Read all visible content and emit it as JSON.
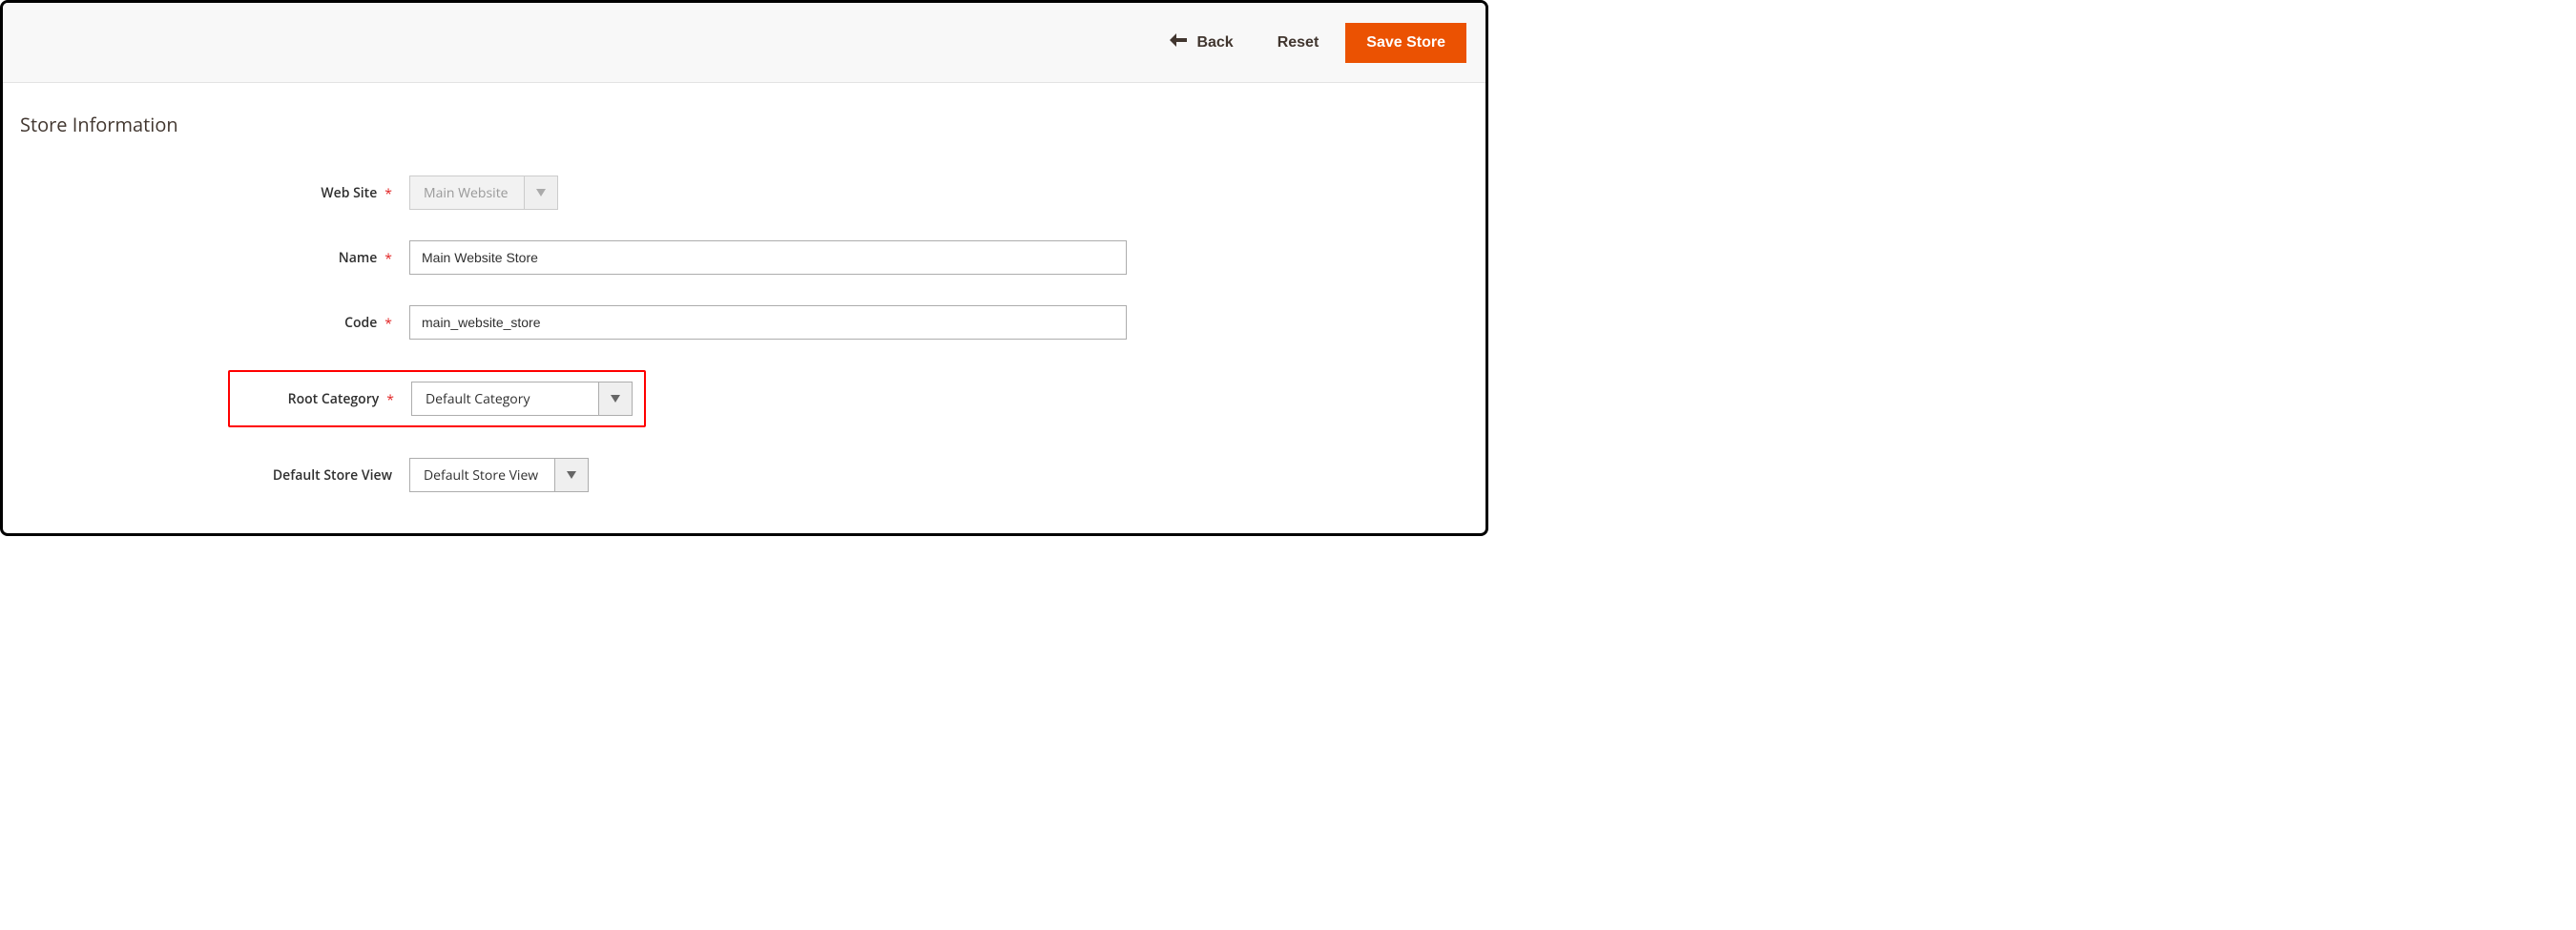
{
  "toolbar": {
    "back_label": "Back",
    "reset_label": "Reset",
    "save_label": "Save Store"
  },
  "section": {
    "title": "Store Information"
  },
  "form": {
    "website": {
      "label": "Web Site",
      "required": "*",
      "value": "Main Website"
    },
    "name": {
      "label": "Name",
      "required": "*",
      "value": "Main Website Store"
    },
    "code": {
      "label": "Code",
      "required": "*",
      "value": "main_website_store"
    },
    "root_category": {
      "label": "Root Category",
      "required": "*",
      "value": "Default Category"
    },
    "default_store_view": {
      "label": "Default Store View",
      "value": "Default Store View"
    }
  }
}
